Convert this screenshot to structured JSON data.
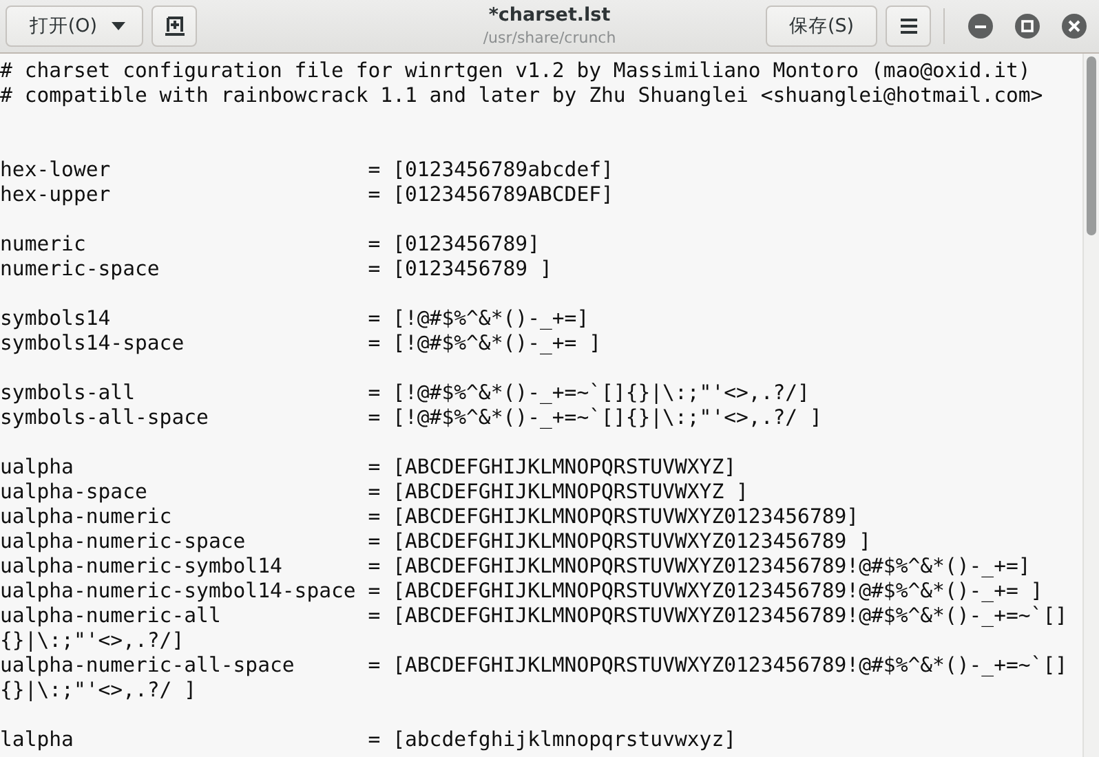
{
  "header": {
    "open_button": "打开(O)",
    "title": "*charset.lst",
    "subtitle": "/usr/share/crunch",
    "save_button": "保存(S)"
  },
  "blocks": [
    {
      "kind": "comment",
      "lines": [
        "# charset configuration file for winrtgen v1.2 by Massimiliano Montoro (mao@oxid.it)",
        "# compatible with rainbowcrack 1.1 and later by Zhu Shuanglei <shuanglei@hotmail.com>"
      ]
    },
    {
      "kind": "settings",
      "lines": [
        "hex-lower                     = [0123456789abcdef]",
        "hex-upper                     = [0123456789ABCDEF]"
      ]
    },
    {
      "kind": "settings",
      "lines": [
        "numeric                       = [0123456789]",
        "numeric-space                 = [0123456789 ]"
      ]
    },
    {
      "kind": "settings",
      "lines": [
        "symbols14                     = [!@#$%^&*()-_+=]",
        "symbols14-space               = [!@#$%^&*()-_+= ]"
      ]
    },
    {
      "kind": "settings",
      "lines": [
        "symbols-all                   = [!@#$%^&*()-_+=~`[]{}|\\:;\"'<>,.?/]",
        "symbols-all-space             = [!@#$%^&*()-_+=~`[]{}|\\:;\"'<>,.?/ ]"
      ]
    },
    {
      "kind": "settings",
      "lines": [
        "ualpha                        = [ABCDEFGHIJKLMNOPQRSTUVWXYZ]",
        "ualpha-space                  = [ABCDEFGHIJKLMNOPQRSTUVWXYZ ]",
        "ualpha-numeric                = [ABCDEFGHIJKLMNOPQRSTUVWXYZ0123456789]",
        "ualpha-numeric-space          = [ABCDEFGHIJKLMNOPQRSTUVWXYZ0123456789 ]",
        "ualpha-numeric-symbol14       = [ABCDEFGHIJKLMNOPQRSTUVWXYZ0123456789!@#$%^&*()-_+=]",
        "ualpha-numeric-symbol14-space = [ABCDEFGHIJKLMNOPQRSTUVWXYZ0123456789!@#$%^&*()-_+= ]",
        "ualpha-numeric-all            = [ABCDEFGHIJKLMNOPQRSTUVWXYZ0123456789!@#$%^&*()-_+=~`[]{}|\\:;\"'<>,.?/]",
        "ualpha-numeric-all-space      = [ABCDEFGHIJKLMNOPQRSTUVWXYZ0123456789!@#$%^&*()-_+=~`[]{}|\\:;\"'<>,.?/ ]"
      ]
    },
    {
      "kind": "settings",
      "lines": [
        "lalpha                        = [abcdefghijklmnopqrstuvwxyz]"
      ]
    }
  ]
}
